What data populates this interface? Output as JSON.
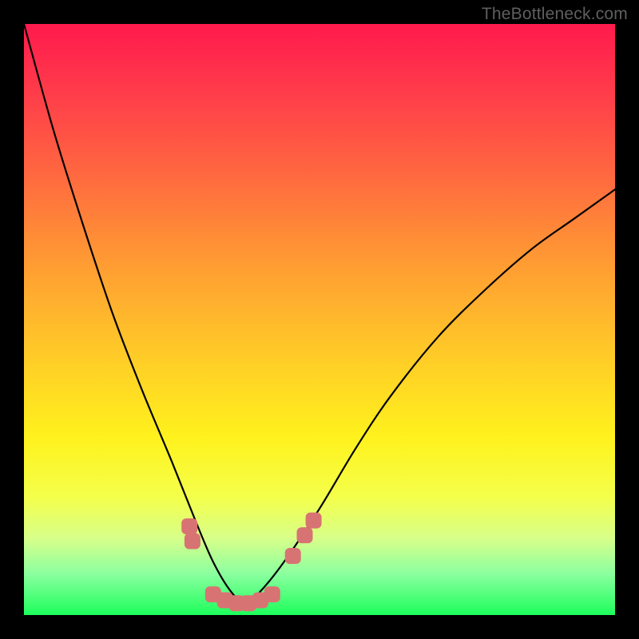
{
  "watermark": "TheBottleneck.com",
  "chart_data": {
    "type": "line",
    "title": "",
    "xlabel": "",
    "ylabel": "",
    "xlim": [
      0,
      100
    ],
    "ylim": [
      0,
      100
    ],
    "grid": false,
    "legend": false,
    "background": {
      "type": "bottleneck-gradient",
      "stops": [
        {
          "pct": 0,
          "color": "#ff1a4d"
        },
        {
          "pct": 12,
          "color": "#ff3d4a"
        },
        {
          "pct": 26,
          "color": "#ff6a3f"
        },
        {
          "pct": 40,
          "color": "#ff9a33"
        },
        {
          "pct": 55,
          "color": "#ffc828"
        },
        {
          "pct": 70,
          "color": "#fff21d"
        },
        {
          "pct": 80,
          "color": "#f4ff4a"
        },
        {
          "pct": 87,
          "color": "#d8ff8a"
        },
        {
          "pct": 93,
          "color": "#8bff9f"
        },
        {
          "pct": 100,
          "color": "#1dff5c"
        }
      ]
    },
    "series": [
      {
        "name": "bottleneck-curve",
        "color": "#000000",
        "x": [
          0,
          5,
          10,
          15,
          20,
          25,
          29,
          32,
          35,
          37.5,
          40,
          44,
          50,
          56,
          62,
          70,
          78,
          86,
          93,
          100
        ],
        "values": [
          100,
          82,
          66,
          51,
          38,
          26,
          16,
          9,
          4,
          2,
          4,
          9,
          18,
          28,
          37,
          47,
          55,
          62,
          67,
          72
        ]
      }
    ],
    "markers": {
      "color": "#d87373",
      "points": [
        {
          "x": 28.0,
          "y": 15.0
        },
        {
          "x": 28.5,
          "y": 12.5
        },
        {
          "x": 32.0,
          "y": 3.5
        },
        {
          "x": 34.0,
          "y": 2.5
        },
        {
          "x": 36.0,
          "y": 2.0
        },
        {
          "x": 38.0,
          "y": 2.0
        },
        {
          "x": 40.0,
          "y": 2.5
        },
        {
          "x": 42.0,
          "y": 3.5
        },
        {
          "x": 45.5,
          "y": 10.0
        },
        {
          "x": 47.5,
          "y": 13.5
        },
        {
          "x": 49.0,
          "y": 16.0
        }
      ]
    }
  }
}
